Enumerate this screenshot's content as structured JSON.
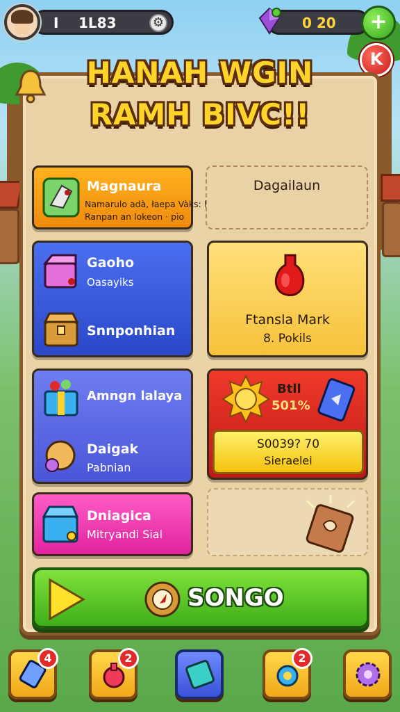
{
  "topbar": {
    "player_label": "I",
    "level_value": "1L83",
    "coins_value": "0 20",
    "add_symbol": "+",
    "close_symbol": "K"
  },
  "title": {
    "line1": "HANAH WGIN",
    "line2": "RAMH BIVC!!"
  },
  "cards": {
    "c1": {
      "title": "Magnaura",
      "subtitle_line1": "Namarulo adà, łaepa Vàks:  la paryla heayal",
      "subtitle_line2": "Ranpan an lokeon  ·  pìo"
    },
    "c2": {
      "title": "Dagailaun"
    },
    "c3": {
      "title": "Gaoho",
      "subtitle": "Oasayiks",
      "second_title": "Snnponhian"
    },
    "c4": {
      "line1": "Ftansla Mark",
      "line2": "8. Pokils"
    },
    "c5": {
      "title": "Amngn lalaya",
      "second_title": "Daigak",
      "second_subtitle": "Pabnian"
    },
    "c6": {
      "badge_line1": "Btll",
      "badge_line2": "501%",
      "button_line1": "S0039? 70",
      "button_line2": "Sieraelei"
    },
    "c7": {
      "title": "Dniagica",
      "subtitle": "Mitryandi Sial"
    }
  },
  "play_button": {
    "label": "SONGO"
  },
  "bottom_nav": {
    "items": [
      {
        "name": "cards",
        "badge": "4"
      },
      {
        "name": "potion",
        "badge": "2"
      },
      {
        "name": "book",
        "badge": ""
      },
      {
        "name": "quest",
        "badge": "2"
      },
      {
        "name": "settings",
        "badge": ""
      }
    ]
  },
  "colors": {
    "title_fill": "#ffd42a",
    "title_stroke": "#5a2e0c",
    "play_green": "#3fae1a",
    "badge_red": "#e32a2a",
    "panel_bg": "#e9d2a6"
  },
  "icons": [
    "gear-icon",
    "gem-icon",
    "plus-icon",
    "close-icon",
    "bell-icon",
    "dragon-icon",
    "chest-icon",
    "potion-icon",
    "gift-icon",
    "sun-coin-icon",
    "card-icon",
    "book-icon",
    "play-triangle-icon",
    "compass-icon"
  ]
}
